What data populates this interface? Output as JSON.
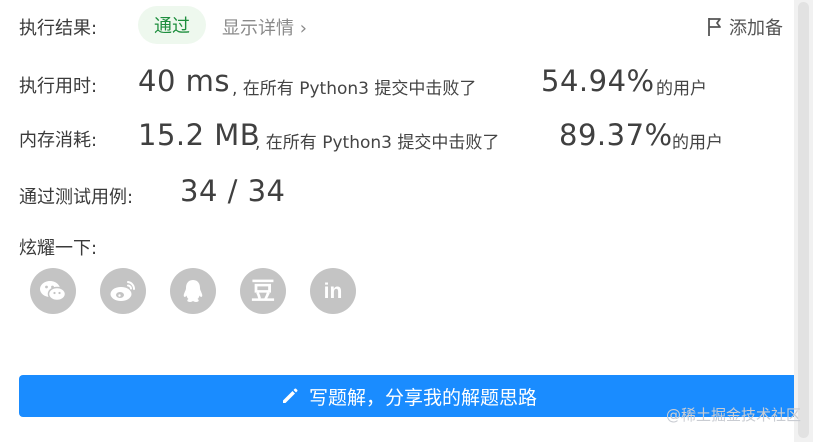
{
  "result": {
    "label": "执行结果:",
    "status": "通过",
    "detail_link": "显示详情",
    "detail_chevron": "›",
    "note_label": "添加备"
  },
  "runtime": {
    "label": "执行用时:",
    "value": "40 ms",
    "mid": ", 在所有 Python3 提交中击败了",
    "percent": "54.94%",
    "suffix": "的用户"
  },
  "memory": {
    "label": "内存消耗:",
    "value": "15.2 MB",
    "mid": ", 在所有 Python3 提交中击败了",
    "percent": "89.37%",
    "suffix": "的用户"
  },
  "tests": {
    "label": "通过测试用例:",
    "value": "34 / 34"
  },
  "share": {
    "label": "炫耀一下:",
    "icons": [
      "wechat-icon",
      "weibo-icon",
      "qq-icon",
      "douban-icon",
      "linkedin-icon"
    ],
    "douban_glyph": "豆",
    "linkedin_glyph": "in"
  },
  "action": {
    "button_label": "写题解，分享我的解题思路"
  },
  "watermark": "@稀土掘金技术社区",
  "colors": {
    "primary": "#1a8cff",
    "success_text": "#1e8e3e",
    "success_bg": "#eef8ee",
    "icon_gray": "#c4c4c4"
  }
}
